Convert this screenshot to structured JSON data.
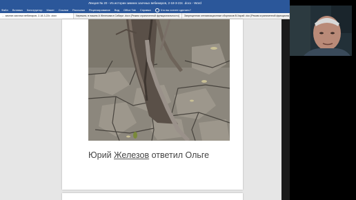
{
  "window": {
    "title": "Лекция № 20 - Из истории зимних заочных вебинаров, 2-18-3-22с .docx - Word"
  },
  "ribbon": {
    "tabs": [
      "Файл",
      "Вставка",
      "Конструктор",
      "Макет",
      "Ссылки",
      "Рассылки",
      "Рецензирование",
      "Вид",
      "Office Tab",
      "Справка"
    ],
    "search_label": "Что вы хотите сделать?"
  },
  "document_tabs": [
    {
      "label": "… зимних заочных вебинаров, 2-18-3-22с .docx",
      "active": true
    },
    {
      "label": "Черешня, в нашем А Железова в Сибири .docx [Режим ограниченной функциональности]",
      "active": false
    },
    {
      "label": "Запрещенная оптимизационные сборников В.Харай .doc [Режим ограниченной функциональности]",
      "active": false
    }
  ],
  "document": {
    "image_alt": "photo-of-dry-cracked-soil-with-tree-trunk",
    "caption_prefix": "Юрий ",
    "caption_name": "Железов",
    "caption_suffix": " ответил Ольге"
  },
  "colors": {
    "ribbon_blue": "#2b579a",
    "canvas_gray": "#e6e6e6",
    "page_white": "#ffffff",
    "outer_black": "#000000"
  }
}
